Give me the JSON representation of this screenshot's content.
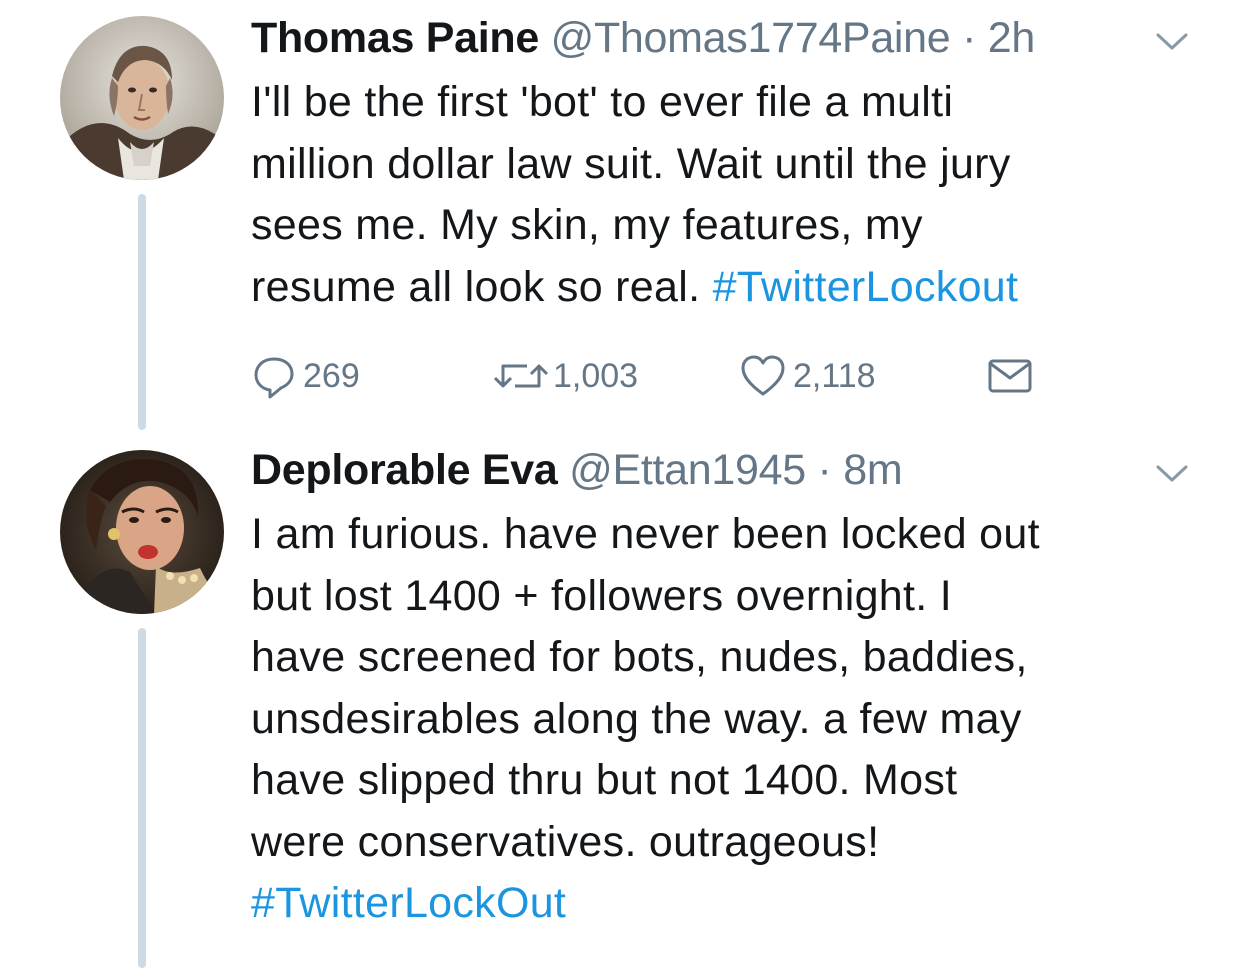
{
  "tweets": [
    {
      "name": "Thomas Paine",
      "handle": "@Thomas1774Paine",
      "separator": "·",
      "time": "2h",
      "text_lines": [
        "I'll be the first 'bot' to ever file a multi",
        "million dollar law suit. Wait until the jury",
        "sees me. My skin, my features, my",
        "resume all look so real. "
      ],
      "hashtag": "#TwitterLockout",
      "replies": "269",
      "retweets": "1,003",
      "likes": "2,118"
    },
    {
      "name": "Deplorable Eva",
      "handle": "@Ettan1945",
      "separator": "·",
      "time": "8m",
      "text_lines": [
        "I am furious. have never been locked out",
        "but lost 1400 + followers overnight. I",
        "have screened for bots, nudes, baddies,",
        "unsdesirables along the way. a few may",
        "have slipped thru but not 1400. Most",
        "were conservatives. outrageous!"
      ],
      "hashtag": "#TwitterLockOut"
    }
  ],
  "colors": {
    "text": "#14171a",
    "secondary": "#657786",
    "link": "#1b95e0",
    "thread_line": "#cdd9e3"
  },
  "icons": {
    "reply": "speech-bubble-icon",
    "retweet": "retweet-arrows-icon",
    "like": "heart-icon",
    "dm": "envelope-icon",
    "menu": "chevron-down-icon"
  }
}
